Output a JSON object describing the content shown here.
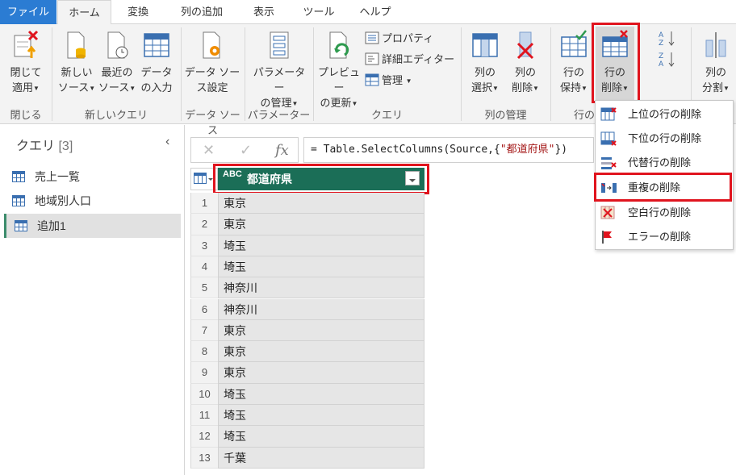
{
  "tabs": [
    "ファイル",
    "ホーム",
    "変換",
    "列の追加",
    "表示",
    "ツール",
    "ヘルプ"
  ],
  "ribbon": {
    "close_apply": [
      "閉じて",
      "適用"
    ],
    "new_source": [
      "新しい",
      "ソース"
    ],
    "recent_source": [
      "最近の",
      "ソース"
    ],
    "enter_data": [
      "データ",
      "の入力"
    ],
    "datasource_settings": [
      "データ ソー",
      "ス設定"
    ],
    "manage_params": [
      "パラメーター",
      "の管理"
    ],
    "refresh_preview": [
      "プレビュー",
      "の更新"
    ],
    "properties": "プロパティ",
    "advanced_editor": "詳細エディター",
    "manage": "管理",
    "choose_columns": [
      "列の",
      "選択"
    ],
    "remove_columns": [
      "列の",
      "削除"
    ],
    "keep_rows": [
      "行の",
      "保持"
    ],
    "remove_rows": [
      "行の",
      "削除"
    ],
    "split_column": [
      "列の",
      "分割"
    ],
    "groups": {
      "close": "閉じる",
      "new_query": "新しいクエリ",
      "data_source": "データ ソース",
      "parameters": "パラメーター",
      "query": "クエリ",
      "manage_columns": "列の管理",
      "reduce_rows": "行の"
    }
  },
  "queries_pane": {
    "title": "クエリ",
    "count": "[3]",
    "items": [
      "売上一覧",
      "地域別人口",
      "追加1"
    ],
    "selected": 2
  },
  "formula_bar": {
    "prefix": "= Table.SelectColumns(Source,{",
    "string": "\"都道府県\"",
    "suffix": "})"
  },
  "grid": {
    "column_type": "ABC",
    "column_header": "都道府県",
    "row_numbers": [
      "1",
      "2",
      "3",
      "4",
      "5",
      "6",
      "7",
      "8",
      "9",
      "10",
      "11",
      "12",
      "13"
    ],
    "rows": [
      "東京",
      "東京",
      "埼玉",
      "埼玉",
      "神奈川",
      "神奈川",
      "東京",
      "東京",
      "東京",
      "埼玉",
      "埼玉",
      "埼玉",
      "千葉"
    ]
  },
  "remove_rows_menu": {
    "items": [
      "上位の行の削除",
      "下位の行の削除",
      "代替行の削除",
      "重複の削除",
      "空白行の削除",
      "エラーの削除"
    ],
    "highlighted": 3
  },
  "colors": {
    "file_tab": "#2b7cd3",
    "header_green": "#1b6e57",
    "highlight_red": "#e0141e"
  }
}
